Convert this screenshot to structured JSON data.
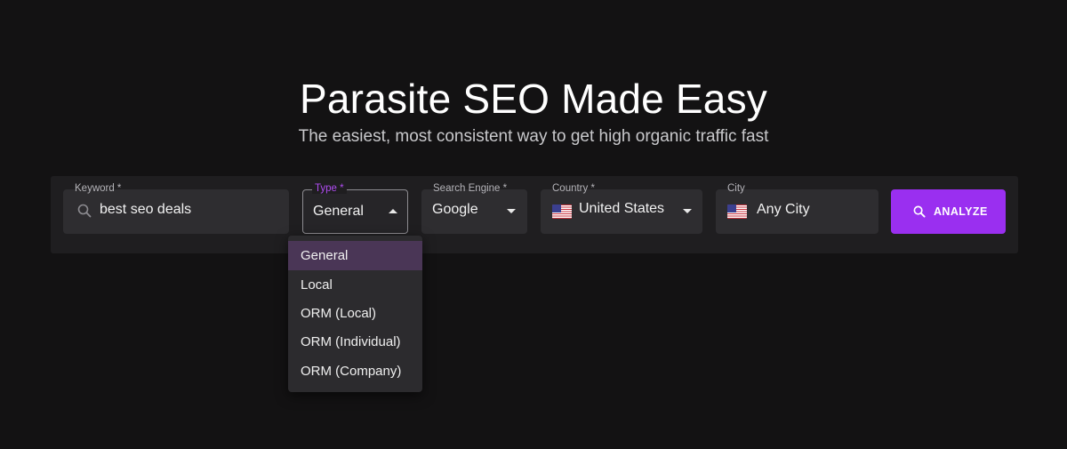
{
  "hero": {
    "title": "Parasite SEO Made Easy",
    "subtitle": "The easiest, most consistent way to get high organic traffic fast"
  },
  "form": {
    "keyword": {
      "label": "Keyword *",
      "value": "best seo deals",
      "icon": "search-icon"
    },
    "type": {
      "label": "Type *",
      "value": "General",
      "open": true
    },
    "search_engine": {
      "label": "Search Engine *",
      "value": "Google"
    },
    "country": {
      "label": "Country *",
      "value": "United States",
      "flag": "us-flag-icon"
    },
    "city": {
      "label": "City",
      "value": "Any City",
      "flag": "us-flag-icon"
    },
    "analyze_button": {
      "label": "ANALYZE",
      "icon": "search-icon"
    }
  },
  "type_dropdown": {
    "options": [
      "General",
      "Local",
      "ORM (Local)",
      "ORM (Individual)",
      "ORM (Company)"
    ],
    "selected": "General"
  },
  "colors": {
    "background": "#131213",
    "accent": "#9a2ff0",
    "focus_label": "#b04cf2",
    "field_bg": "#2e2d30",
    "selected_option_bg": "#4a3656"
  }
}
